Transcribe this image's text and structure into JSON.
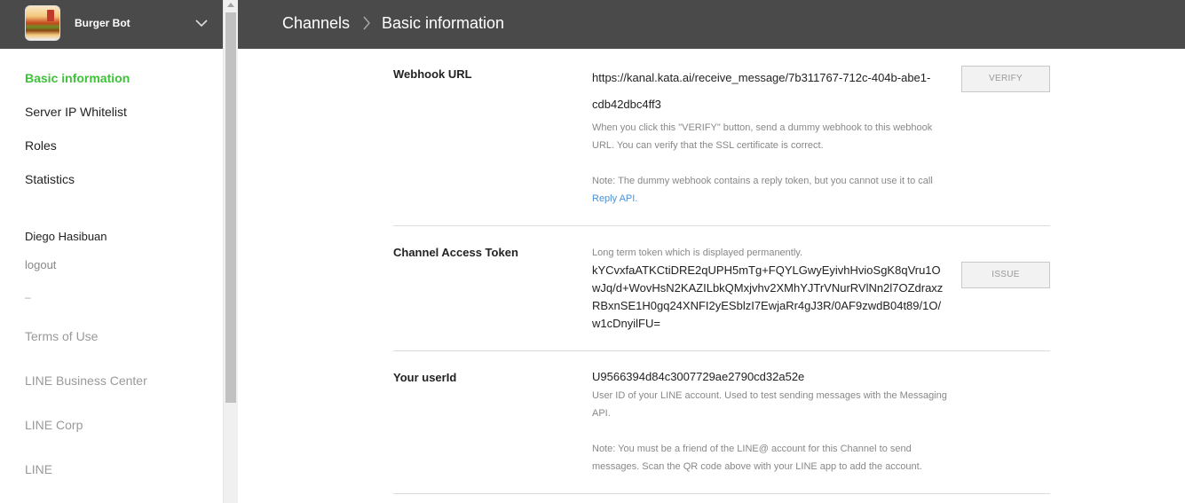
{
  "sidebar": {
    "bot_name": "Burger Bot",
    "nav": [
      {
        "label": "Basic information",
        "active": true
      },
      {
        "label": "Server IP Whitelist",
        "active": false
      },
      {
        "label": "Roles",
        "active": false
      },
      {
        "label": "Statistics",
        "active": false
      }
    ],
    "user_name": "Diego Hasibuan",
    "logout": "logout",
    "separator": "–",
    "footer_links": [
      "Terms of Use",
      "LINE Business Center",
      "LINE Corp",
      "LINE"
    ]
  },
  "header": {
    "breadcrumb_parent": "Channels",
    "breadcrumb_current": "Basic information"
  },
  "webhook": {
    "label": "Webhook URL",
    "url_line1": "https://kanal.kata.ai/receive_message/7b311767-712c-404b-abe1-",
    "url_line2": "cdb42dbc4ff3",
    "verify_label": "VERIFY",
    "help1": "When you click this \"VERIFY\" button, send a dummy webhook to this webhook URL. You can verify that the SSL certificate is correct.",
    "help2": "Note: The dummy webhook contains a reply token, but you cannot use it to call",
    "help2_link": "Reply API."
  },
  "access_token": {
    "label": "Channel Access Token",
    "help": "Long term token which is displayed permanently.",
    "token": "kYCvxfaATKCtiDRE2qUPH5mTg+FQYLGwyEyivhHvioSgK8qVru1OwJq/d+WovHsN2KAZILbkQMxjvhv2XMhYJTrVNurRVlNn2l7OZdraxzRBxnSE1H0gq24XNFI2yESblzI7EwjaRr4gJ3R/0AF9zwdB04t89/1O/w1cDnyilFU=",
    "issue_label": "ISSUE"
  },
  "user_id": {
    "label": "Your userId",
    "value": "U9566394d84c3007729ae2790cd32a52e",
    "help1": "User ID of your LINE account. Used to test sending messages with the Messaging API.",
    "help2": "Note: You must be a friend of the LINE@ account for this Channel to send messages. Scan the QR code above with your LINE app to add the account."
  },
  "colors": {
    "header_bg": "#4a4a4a",
    "active_nav": "#3ec239",
    "link": "#4a90d9"
  }
}
